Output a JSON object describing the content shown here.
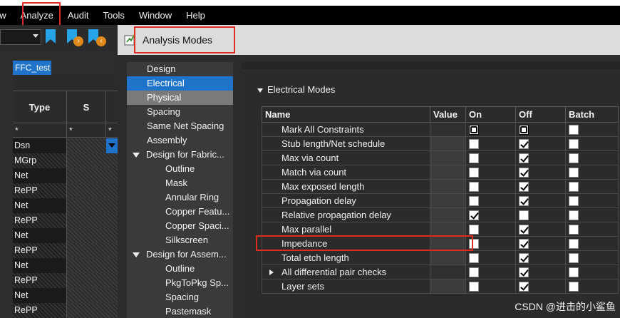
{
  "menubar": {
    "items": [
      "ew",
      "Analyze",
      "Audit",
      "Tools",
      "Window",
      "Help"
    ]
  },
  "left_panel": {
    "tab_label": "FFC_test",
    "columns": [
      "Type",
      "S"
    ],
    "filter_values": [
      "*",
      "*",
      "*"
    ],
    "rows": [
      "Dsn",
      "MGrp",
      "Net",
      "RePP",
      "Net",
      "RePP",
      "Net",
      "RePP",
      "Net",
      "RePP",
      "Net",
      "RePP"
    ]
  },
  "dialog": {
    "title": "Analysis Modes",
    "nav": [
      {
        "label": "Design",
        "indent": 0,
        "expander": false,
        "state": ""
      },
      {
        "label": "Electrical",
        "indent": 0,
        "expander": false,
        "state": "selected"
      },
      {
        "label": "Physical",
        "indent": 0,
        "expander": false,
        "state": "highlighted"
      },
      {
        "label": "Spacing",
        "indent": 0,
        "expander": false,
        "state": ""
      },
      {
        "label": "Same Net Spacing",
        "indent": 0,
        "expander": false,
        "state": ""
      },
      {
        "label": "Assembly",
        "indent": 0,
        "expander": false,
        "state": ""
      },
      {
        "label": "Design for Fabric...",
        "indent": 0,
        "expander": true,
        "state": ""
      },
      {
        "label": "Outline",
        "indent": 1,
        "expander": false,
        "state": ""
      },
      {
        "label": "Mask",
        "indent": 1,
        "expander": false,
        "state": ""
      },
      {
        "label": "Annular Ring",
        "indent": 1,
        "expander": false,
        "state": ""
      },
      {
        "label": "Copper Featu...",
        "indent": 1,
        "expander": false,
        "state": ""
      },
      {
        "label": "Copper Spaci...",
        "indent": 1,
        "expander": false,
        "state": ""
      },
      {
        "label": "Silkscreen",
        "indent": 1,
        "expander": false,
        "state": ""
      },
      {
        "label": "Design for Assem...",
        "indent": 0,
        "expander": true,
        "state": ""
      },
      {
        "label": "Outline",
        "indent": 1,
        "expander": false,
        "state": ""
      },
      {
        "label": "PkgToPkg Sp...",
        "indent": 1,
        "expander": false,
        "state": ""
      },
      {
        "label": "Spacing",
        "indent": 1,
        "expander": false,
        "state": ""
      },
      {
        "label": "Pastemask",
        "indent": 1,
        "expander": false,
        "state": ""
      }
    ],
    "section_title": "Electrical Modes",
    "table": {
      "columns": [
        "Name",
        "Value",
        "On",
        "Off",
        "Batch"
      ],
      "rows": [
        {
          "name": "Mark All Constraints",
          "on": "partial",
          "off": "partial",
          "batch": "unchecked",
          "expander": false
        },
        {
          "name": "Stub length/Net schedule",
          "on": "unchecked",
          "off": "checked",
          "batch": "unchecked",
          "expander": false
        },
        {
          "name": "Max via count",
          "on": "unchecked",
          "off": "checked",
          "batch": "unchecked",
          "expander": false
        },
        {
          "name": "Match via count",
          "on": "unchecked",
          "off": "checked",
          "batch": "unchecked",
          "expander": false
        },
        {
          "name": "Max exposed length",
          "on": "unchecked",
          "off": "checked",
          "batch": "unchecked",
          "expander": false
        },
        {
          "name": "Propagation delay",
          "on": "unchecked",
          "off": "checked",
          "batch": "unchecked",
          "expander": false
        },
        {
          "name": "Relative propagation delay",
          "on": "checked",
          "off": "unchecked",
          "batch": "unchecked",
          "expander": false
        },
        {
          "name": "Max parallel",
          "on": "unchecked",
          "off": "checked",
          "batch": "unchecked",
          "expander": false
        },
        {
          "name": "Impedance",
          "on": "unchecked",
          "off": "checked",
          "batch": "unchecked",
          "expander": false
        },
        {
          "name": "Total etch length",
          "on": "unchecked",
          "off": "checked",
          "batch": "unchecked",
          "expander": false
        },
        {
          "name": "All differential pair checks",
          "on": "unchecked",
          "off": "checked",
          "batch": "unchecked",
          "expander": true
        },
        {
          "name": "Layer sets",
          "on": "unchecked",
          "off": "checked",
          "batch": "unchecked",
          "expander": false
        }
      ]
    }
  },
  "watermark": "CSDN @进击的小鲨鱼",
  "colors": {
    "highlight_box": "#e02b20",
    "selection_blue": "#1f74c9",
    "menubar_bg": "#000000"
  }
}
